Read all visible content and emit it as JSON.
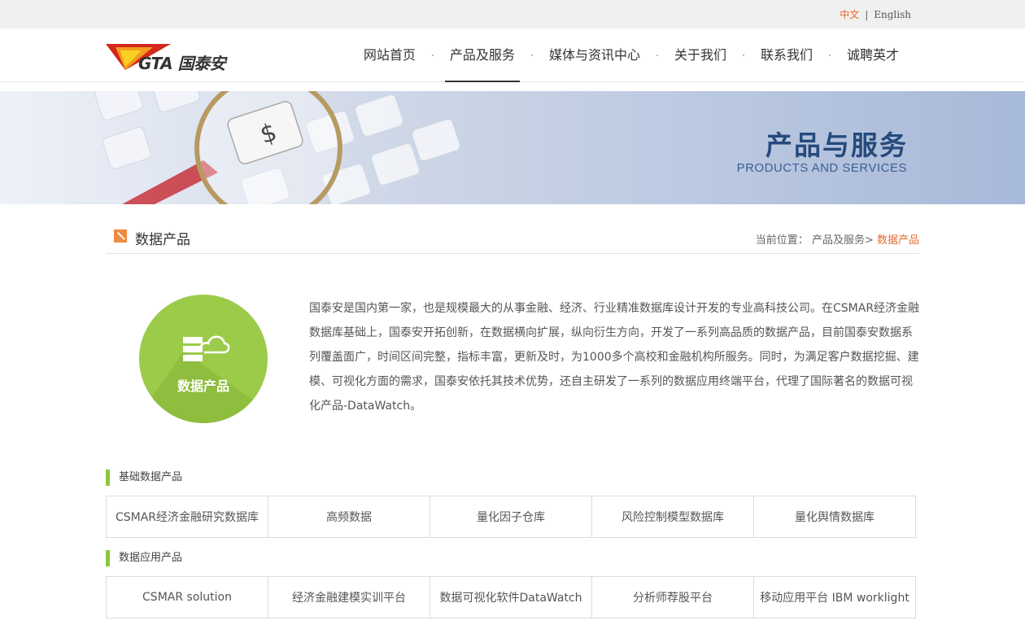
{
  "lang": {
    "chinese": "中文",
    "separator": "|",
    "english": "English"
  },
  "logo": {
    "text": "GTA 国泰安"
  },
  "nav": [
    {
      "label": "网站首页"
    },
    {
      "label": "产品及服务"
    },
    {
      "label": "媒体与资讯中心"
    },
    {
      "label": "关于我们"
    },
    {
      "label": "联系我们"
    },
    {
      "label": "诚聘英才"
    }
  ],
  "banner": {
    "title": "产品与服务",
    "subtitle": "PRODUCTS AND SERVICES"
  },
  "section": {
    "title": "数据产品"
  },
  "breadcrumb": {
    "prefix": "当前位置：",
    "parent": "产品及服务>",
    "current": "数据产品"
  },
  "intro": {
    "circle_label": "数据产品",
    "text": "国泰安是国内第一家，也是规模最大的从事金融、经济、行业精准数据库设计开发的专业高科技公司。在CSMAR经济金融数据库基础上，国泰安开拓创新，在数据横向扩展，纵向衍生方向，开发了一系列高品质的数据产品，目前国泰安数据系列覆盖面广，时间区间完整，指标丰富，更新及时，为1000多个高校和金融机构所服务。同时，为满足客户数据挖掘、建模、可视化方面的需求，国泰安依托其技术优势，还自主研发了一系列的数据应用终端平台，代理了国际著名的数据可视化产品-DataWatch。"
  },
  "groups": [
    {
      "title": "基础数据产品",
      "items": [
        "CSMAR经济金融研究数据库",
        "高频数据",
        "量化因子仓库",
        "风险控制模型数据库",
        "量化舆情数据库"
      ]
    },
    {
      "title": "数据应用产品",
      "items": [
        "CSMAR solution",
        "经济金融建模实训平台",
        "数据可视化软件DataWatch",
        "分析师荐股平台",
        "移动应用平台 IBM worklight"
      ]
    }
  ],
  "colors": {
    "accent": "#e8692e",
    "green": "#9ccb4a",
    "banner_text": "#264a7c"
  }
}
